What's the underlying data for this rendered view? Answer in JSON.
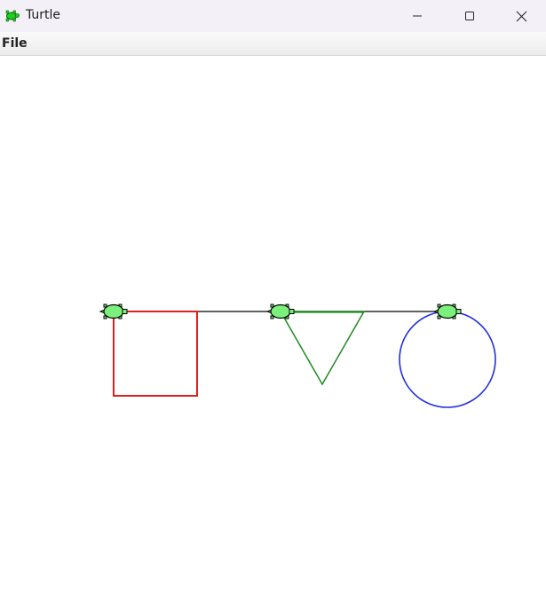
{
  "window": {
    "title": "Turtle",
    "icon": "turtle-icon",
    "controls": [
      "minimize-icon",
      "maximize-icon",
      "close-icon"
    ]
  },
  "menubar": {
    "items": [
      {
        "label": "File"
      }
    ]
  },
  "canvas": {
    "background": "#ffffff",
    "turtle_color": "#7cf07c",
    "shapes": [
      {
        "kind": "square",
        "color": "#e02020"
      },
      {
        "kind": "triangle",
        "color": "#1e8a1e"
      },
      {
        "kind": "circle",
        "color": "#1f2fd8"
      }
    ],
    "connector_color": "#000000",
    "turtle_count": 3
  }
}
